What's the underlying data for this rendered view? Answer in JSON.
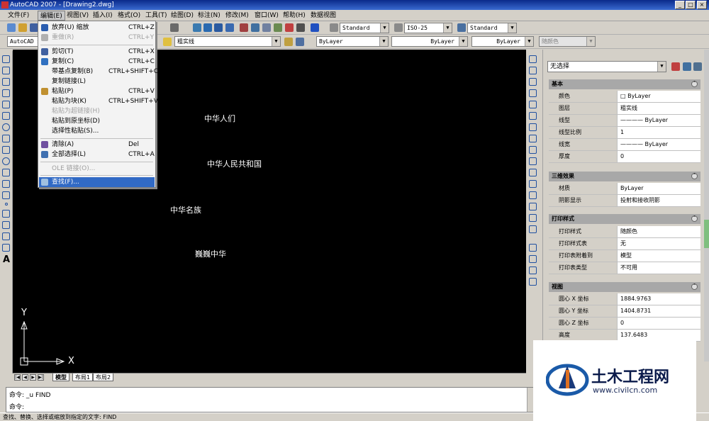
{
  "window": {
    "title": "AutoCAD 2007 - [Drawing2.dwg]"
  },
  "menubar": [
    "文件(F)",
    "编辑(E)",
    "视图(V)",
    "插入(I)",
    "格式(O)",
    "工具(T)",
    "绘图(D)",
    "标注(N)",
    "修改(M)",
    "窗口(W)",
    "帮助(H)",
    "数据视图"
  ],
  "toolbar": {
    "textstyle": "Standard",
    "dimstyle": "ISO-25",
    "tablestyle": "Standard",
    "workspace": "AutoCAD 经",
    "layer": "粗实线",
    "color": "ByLayer",
    "linetype": "ByLayer",
    "lineweight": "ByLayer",
    "plotstyle": "随颜色"
  },
  "edit_menu": [
    {
      "label": "放弃(U) 缩放",
      "shortcut": "CTRL+Z",
      "disabled": false,
      "icon": "undo-icon",
      "color": "#2a5db0"
    },
    {
      "label": "重做(R)",
      "shortcut": "CTRL+Y",
      "disabled": true,
      "icon": "redo-icon",
      "color": "#b0b0b0"
    },
    {
      "label": "剪切(T)",
      "shortcut": "CTRL+X",
      "disabled": false,
      "icon": "cut-icon",
      "color": "#4060a0"
    },
    {
      "label": "复制(C)",
      "shortcut": "CTRL+C",
      "disabled": false,
      "icon": "copy-icon",
      "color": "#3070c0"
    },
    {
      "label": "带基点复制(B)",
      "shortcut": "CTRL+SHIFT+C",
      "disabled": false,
      "icon": "",
      "color": ""
    },
    {
      "label": "复制链接(L)",
      "shortcut": "",
      "disabled": false,
      "icon": "",
      "color": ""
    },
    {
      "label": "粘贴(P)",
      "shortcut": "CTRL+V",
      "disabled": false,
      "icon": "paste-icon",
      "color": "#c09030"
    },
    {
      "label": "粘贴为块(K)",
      "shortcut": "CTRL+SHIFT+V",
      "disabled": false,
      "icon": "",
      "color": ""
    },
    {
      "label": "粘贴为超链接(H)",
      "shortcut": "",
      "disabled": true,
      "icon": "",
      "color": ""
    },
    {
      "label": "粘贴到原坐标(D)",
      "shortcut": "",
      "disabled": false,
      "icon": "",
      "color": ""
    },
    {
      "label": "选择性粘贴(S)...",
      "shortcut": "",
      "disabled": false,
      "icon": "",
      "color": ""
    },
    {
      "label": "清除(A)",
      "shortcut": "Del",
      "disabled": false,
      "icon": "eraser-icon",
      "color": "#7050a0"
    },
    {
      "label": "全部选择(L)",
      "shortcut": "CTRL+A",
      "disabled": false,
      "icon": "select-all-icon",
      "color": "#4070b0"
    },
    {
      "label": "OLE 链接(O)...",
      "shortcut": "",
      "disabled": true,
      "icon": "",
      "color": ""
    },
    {
      "label": "查找(F)...",
      "shortcut": "",
      "disabled": false,
      "icon": "find-icon",
      "color": "#3060a0"
    }
  ],
  "drawing_texts": [
    "中华人们",
    "中华人民共和国",
    "中华名族",
    "巍巍中华"
  ],
  "ucs": {
    "x": "X",
    "y": "Y"
  },
  "layout_tabs": [
    "模型",
    "布局1",
    "布局2"
  ],
  "command": {
    "line1": "命令: _u FIND",
    "line2": "命令:"
  },
  "status": "查找、替换、选择或缩放到指定的文字:  FIND",
  "properties": {
    "selection": "无选择",
    "sections": [
      {
        "title": "基本",
        "rows": [
          {
            "k": "颜色",
            "v": "□ ByLayer"
          },
          {
            "k": "图层",
            "v": "粗实线"
          },
          {
            "k": "线型",
            "v": "———— ByLayer"
          },
          {
            "k": "线型比例",
            "v": "1"
          },
          {
            "k": "线宽",
            "v": "———— ByLayer"
          },
          {
            "k": "厚度",
            "v": "0"
          }
        ]
      },
      {
        "title": "三维效果",
        "rows": [
          {
            "k": "材质",
            "v": "ByLayer"
          },
          {
            "k": "阴影显示",
            "v": "投射和接收阴影"
          }
        ]
      },
      {
        "title": "打印样式",
        "rows": [
          {
            "k": "打印样式",
            "v": "随颜色"
          },
          {
            "k": "打印样式表",
            "v": "无"
          },
          {
            "k": "打印表附着到",
            "v": "模型"
          },
          {
            "k": "打印表类型",
            "v": "不可用"
          }
        ]
      },
      {
        "title": "视图",
        "rows": [
          {
            "k": "圆心 X 坐标",
            "v": "1884.9763"
          },
          {
            "k": "圆心 Y 坐标",
            "v": "1404.8731"
          },
          {
            "k": "圆心 Z 坐标",
            "v": "0"
          },
          {
            "k": "高度",
            "v": "137.6483"
          }
        ]
      }
    ]
  },
  "watermark": {
    "title": "土木工程网",
    "url": "www.civilcn.com"
  }
}
